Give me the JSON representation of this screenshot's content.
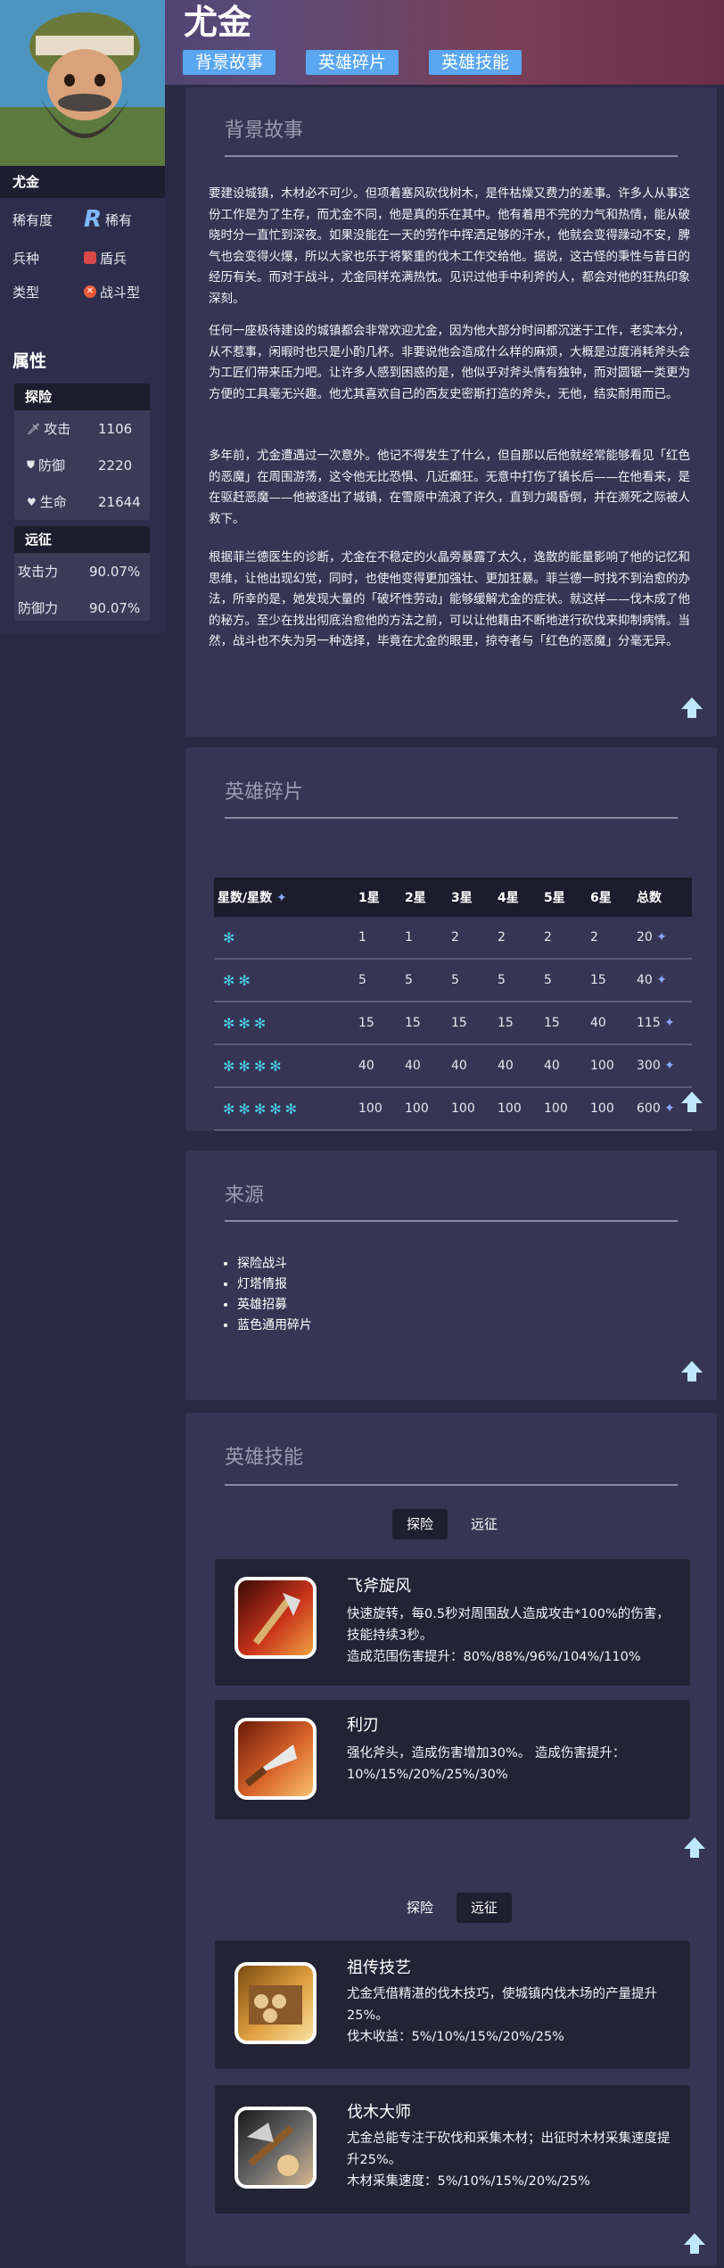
{
  "hero": {
    "title": "尤金",
    "name": "尤金",
    "rarity_label": "稀有度",
    "rarity_value": "稀有",
    "rarity_badge": "R",
    "class_label": "兵种",
    "class_value": "盾兵",
    "type_label": "类型",
    "type_value": "战斗型"
  },
  "top_tabs": [
    "背景故事",
    "英雄碎片",
    "英雄技能"
  ],
  "attributes": {
    "title": "属性",
    "explore": {
      "head": "探险",
      "rows": [
        {
          "icon": "sword-icon",
          "label": "攻击",
          "value": "1106"
        },
        {
          "icon": "shield-icon",
          "label": "防御",
          "value": "2220"
        },
        {
          "icon": "heart-icon",
          "label": "生命",
          "value": "21644"
        }
      ]
    },
    "expedition": {
      "head": "远征",
      "rows": [
        {
          "label": "攻击力",
          "value": "90.07%"
        },
        {
          "label": "防御力",
          "value": "90.07%"
        }
      ]
    }
  },
  "story": {
    "title": "背景故事",
    "paragraphs": [
      "要建设城镇，木材必不可少。但项着塞风砍伐树木，是件枯燥又费力的差事。许多人从事这份工作是为了生存，而尤金不同，他是真的乐在其中。他有着用不完的力气和热情，能从破晓时分一直忙到深夜。如果没能在一天的劳作中挥洒足够的汗水，他就会变得躁动不安，脾气也会变得火爆，所以大家也乐于将繁重的伐木工作交给他。据说，这古怪的秉性与昔日的经历有关。而对于战斗，尤金同样充满热忱。见识过他手中利斧的人，都会对他的狂热印象深刻。",
      "任何一座极待建设的城镇都会非常欢迎尤金，因为他大部分时间都沉迷于工作，老实本分，从不惹事，闲暇时也只是小酌几杯。非要说他会造成什么样的麻烦，大概是过度消耗斧头会为工匠们带来压力吧。让许多人感到困惑的是，他似乎对斧头情有独钟，而对圆锯一类更为方便的工具毫无兴趣。他尤其喜欢自己的西友史密斯打造的斧头，无他，结实耐用而已。",
      "多年前，尤金遭遇过一次意外。他记不得发生了什么，但自那以后他就经常能够看见「红色的恶魔」在周围游荡，这令他无比恐惧、几近癫狂。无意中打伤了镇长后——在他看来，是在驱赶恶魔——他被逐出了城镇，在雪原中流浪了许久，直到力竭昏倒，并在濒死之际被人救下。",
      "根据菲兰德医生的诊断，尤金在不稳定的火晶旁暴露了太久，逸散的能量影响了他的记忆和思维，让他出现幻觉，同时，也使他变得更加强壮、更加狂暴。菲兰德一时找不到治愈的办法，所幸的是，她发现大量的「破坏性劳动」能够缓解尤金的症状。就这样——伐木成了他的秘方。至少在找出彻底治愈他的方法之前，可以让他籍由不断地进行砍伐来抑制病情。当然，战斗也不失为另一种选择，毕竟在尤金的眼里，掠夺者与「红色的恶魔」分毫无异。"
    ]
  },
  "shards": {
    "title": "英雄碎片",
    "headers": [
      "星数/星数",
      "1星",
      "2星",
      "3星",
      "4星",
      "5星",
      "6星",
      "总数"
    ],
    "rows": [
      {
        "stars": 1,
        "values": [
          "1",
          "1",
          "2",
          "2",
          "2",
          "2",
          "20"
        ]
      },
      {
        "stars": 2,
        "values": [
          "5",
          "5",
          "5",
          "5",
          "5",
          "15",
          "40"
        ]
      },
      {
        "stars": 3,
        "values": [
          "15",
          "15",
          "15",
          "15",
          "15",
          "40",
          "115"
        ]
      },
      {
        "stars": 4,
        "values": [
          "40",
          "40",
          "40",
          "40",
          "40",
          "100",
          "300"
        ]
      },
      {
        "stars": 5,
        "values": [
          "100",
          "100",
          "100",
          "100",
          "100",
          "100",
          "600"
        ]
      }
    ]
  },
  "source": {
    "title": "来源",
    "items": [
      "探险战斗",
      "灯塔情报",
      "英雄招募",
      "蓝色通用碎片"
    ]
  },
  "skills": {
    "title": "英雄技能",
    "tab_explore": "探险",
    "tab_expedition": "远征",
    "explore": [
      {
        "name": "飞斧旋风",
        "desc": "快速旋转，每0.5秒对周围敌人造成攻击*100%的伤害，技能持续3秒。",
        "desc2": "造成范围伤害提升：80%/88%/96%/104%/110%"
      },
      {
        "name": "利刃",
        "desc": "强化斧头，造成伤害增加30%。 造成伤害提升：10%/15%/20%/25%/30%",
        "desc2": ""
      }
    ],
    "expedition": [
      {
        "name": "祖传技艺",
        "desc": "尤金凭借精湛的伐木技巧，使城镇内伐木场的产量提升25%。",
        "desc2": "伐木收益：5%/10%/15%/20%/25%"
      },
      {
        "name": "伐木大师",
        "desc": "尤金总能专注于砍伐和采集木材；出征时木材采集速度提升25%。",
        "desc2": "木材采集速度：5%/10%/15%/20%/25%"
      }
    ]
  },
  "colors": {
    "accent": "#5aa6f0",
    "star": "#4ad0e8",
    "card": "#363654",
    "page": "#2a2a45"
  }
}
